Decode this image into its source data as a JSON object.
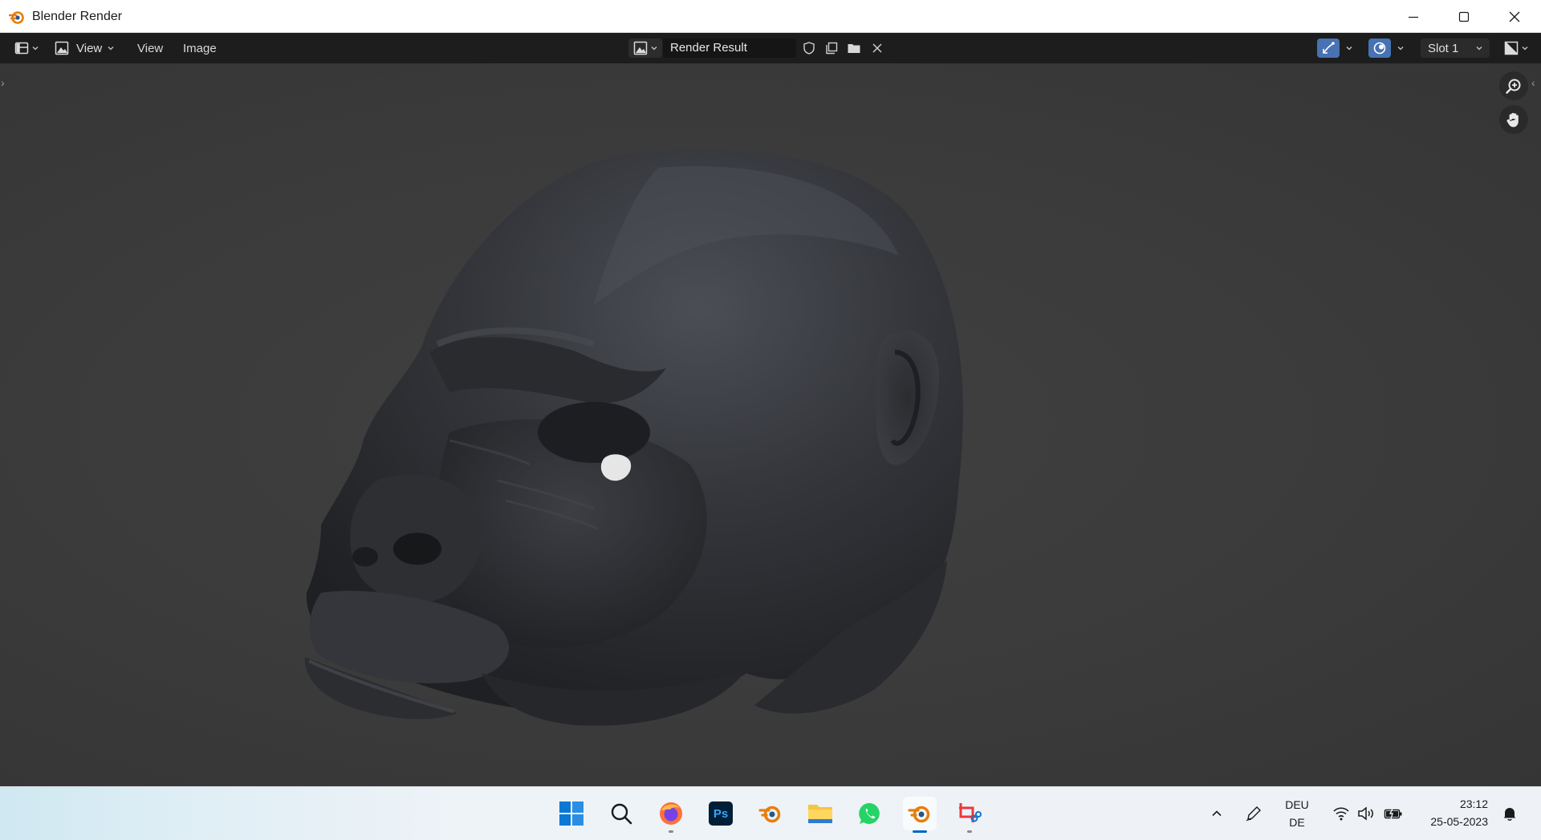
{
  "window": {
    "title": "Blender Render"
  },
  "header": {
    "view_menu_label": "View",
    "menu_view": "View",
    "menu_image": "Image",
    "image_name": "Render Result",
    "slot_label": "Slot 1"
  },
  "taskbar": {
    "apps": [
      "start",
      "search",
      "firefox",
      "photoshop",
      "blender",
      "file-explorer",
      "whatsapp",
      "blender-active",
      "snipping-tool"
    ],
    "ps_label": "Ps",
    "lang_top": "DEU",
    "lang_bottom": "DE",
    "time": "23:12",
    "date": "25-05-2023"
  },
  "colors": {
    "accent_blue": "#4772b3",
    "blender_orange": "#e87d0d",
    "taskbar_indicator": "#0067c0"
  }
}
